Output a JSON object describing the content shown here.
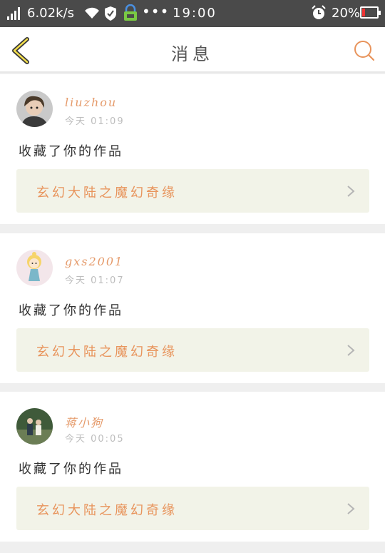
{
  "status_bar": {
    "speed": "6.02k/s",
    "time": "19:00",
    "battery_percent": "20%",
    "battery_level": 0.2
  },
  "nav": {
    "title": "消息"
  },
  "messages": [
    {
      "username": "liuzhou",
      "time": "今天 01:09",
      "action": "收藏了你的作品",
      "work_title": "玄幻大陆之魔幻奇缘"
    },
    {
      "username": "gxs2001",
      "time": "今天 01:07",
      "action": "收藏了你的作品",
      "work_title": "玄幻大陆之魔幻奇缘"
    },
    {
      "username": "蒋小狗",
      "time": "今天 00:05",
      "action": "收藏了你的作品",
      "work_title": "玄幻大陆之魔幻奇缘"
    }
  ],
  "colors": {
    "accent": "#e8945c",
    "status_bar_bg": "#4a4a4a",
    "work_bg": "#f2f3e8"
  }
}
